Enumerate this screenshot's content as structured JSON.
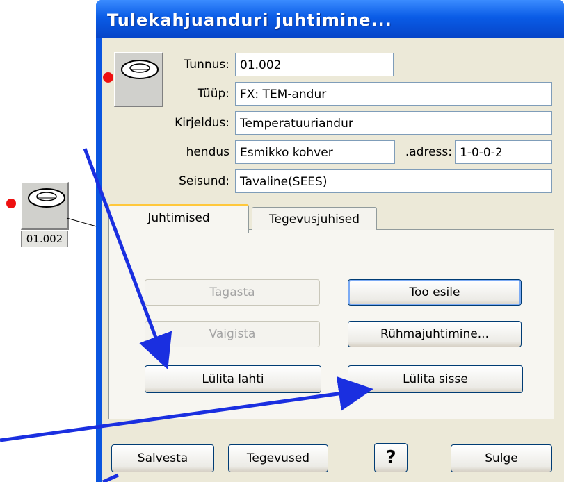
{
  "window": {
    "title": "Tulekahjuanduri juhtimine..."
  },
  "background_device": {
    "label": "01.002"
  },
  "fields": {
    "tunnus": {
      "label": "Tunnus:",
      "value": "01.002"
    },
    "tyyp": {
      "label": "Tüüp:",
      "value": "FX: TEM-andur"
    },
    "kirjeldus": {
      "label": "Kirjeldus:",
      "value": "Temperatuuriandur"
    },
    "hendus": {
      "label": "hendus",
      "value": "Esmikko kohver"
    },
    "adress": {
      "label": ".adress:",
      "value": "1-0-0-2"
    },
    "seisund": {
      "label": "Seisund:",
      "value": "Tavaline(SEES)"
    }
  },
  "tabs": [
    {
      "label": "Juhtimised",
      "active": true
    },
    {
      "label": "Tegevusjuhised",
      "active": false
    }
  ],
  "controls": {
    "tagasta": "Tagasta",
    "too_esile": "Too esile",
    "vaigista": "Vaigista",
    "ryhmajuhtimine": "Rühmajuhtimine...",
    "lylita_lahti": "Lülita lahti",
    "lylita_sisse": "Lülita sisse"
  },
  "footer": {
    "salvesta": "Salvesta",
    "tegevused": "Tegevused",
    "help": "?",
    "sulge": "Sulge"
  },
  "colors": {
    "titlebar": "#0a5ce6",
    "annotation_arrow": "#1a2fe0",
    "alarm_dot": "#ee1010",
    "tab_highlight": "#ffc83c"
  }
}
